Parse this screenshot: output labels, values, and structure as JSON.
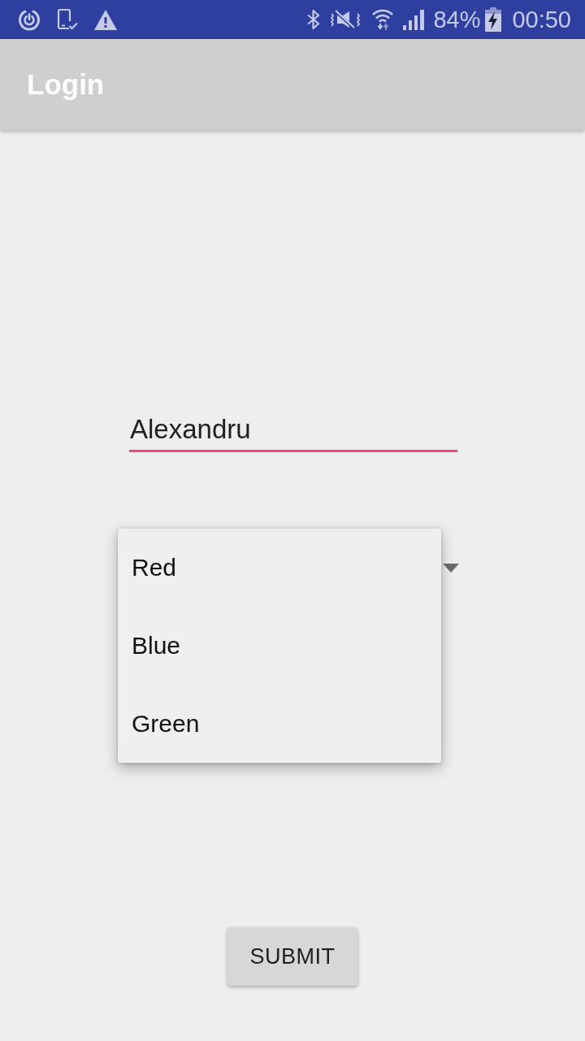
{
  "status_bar": {
    "battery": "84%",
    "time": "00:50"
  },
  "app_bar": {
    "title": "Login"
  },
  "name_field": {
    "value": "Alexandru",
    "focused": true
  },
  "color_spinner": {
    "expanded": true,
    "options": [
      {
        "label": "Red"
      },
      {
        "label": "Blue"
      },
      {
        "label": "Green"
      }
    ]
  },
  "submit_button": {
    "label": "SUBMIT"
  }
}
